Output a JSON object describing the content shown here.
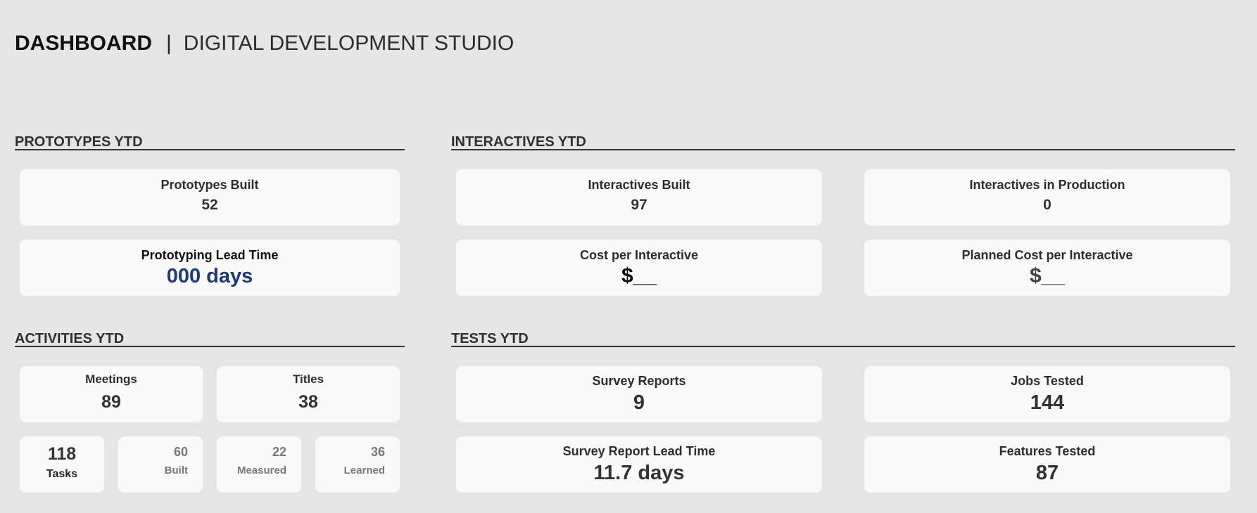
{
  "header": {
    "title": "DASHBOARD",
    "separator": "|",
    "subtitle": "DIGITAL DEVELOPMENT STUDIO"
  },
  "sections": {
    "prototypes": "PROTOTYPES YTD",
    "interactives": "INTERACTIVES YTD",
    "activities": "ACTIVITIES YTD",
    "tests": "TESTS YTD"
  },
  "prototypes": {
    "built_label": "Prototypes Built",
    "built_value": "52",
    "lead_label": "Prototyping Lead Time",
    "lead_value": "000 days"
  },
  "interactives": {
    "built_label": "Interactives Built",
    "built_value": "97",
    "production_label": "Interactives in Production",
    "production_value": "0",
    "cost_label": "Cost per Interactive",
    "cost_value": "$__",
    "planned_label": "Planned Cost per Interactive",
    "planned_value": "$__"
  },
  "activities": {
    "meetings_label": "Meetings",
    "meetings_value": "89",
    "titles_label": "Titles",
    "titles_value": "38",
    "tasks_value": "118",
    "tasks_label": "Tasks",
    "built_value": "60",
    "built_label": "Built",
    "measured_value": "22",
    "measured_label": "Measured",
    "learned_value": "36",
    "learned_label": "Learned"
  },
  "tests": {
    "survey_label": "Survey Reports",
    "survey_value": "9",
    "jobs_label": "Jobs Tested",
    "jobs_value": "144",
    "lead_label": "Survey Report Lead Time",
    "lead_value": "11.7 days",
    "features_label": "Features Tested",
    "features_value": "87"
  },
  "colors": {
    "background": "#e5e5e5",
    "card": "#f9f9f9",
    "lead_accent": "#1f3a73"
  }
}
